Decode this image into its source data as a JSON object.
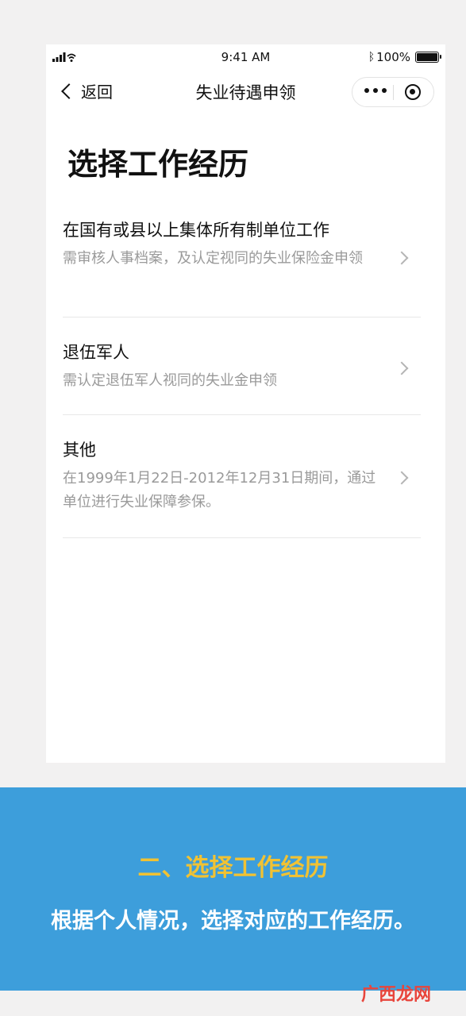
{
  "status_bar": {
    "time": "9:41 AM",
    "battery": "100%"
  },
  "navbar": {
    "back_label": "返回",
    "title": "失业待遇申领"
  },
  "page": {
    "title": "选择工作经历"
  },
  "options": [
    {
      "title": "在国有或县以上集体所有制单位工作",
      "desc": "需审核人事档案，及认定视同的失业保险金申领"
    },
    {
      "title": "退伍军人",
      "desc": "需认定退伍军人视同的失业金申领"
    },
    {
      "title": "其他",
      "desc": "在1999年1月22日-2012年12月31日期间，通过单位进行失业保障参保。"
    }
  ],
  "banner": {
    "heading": "二、选择工作经历",
    "text": "根据个人情况，选择对应的工作经历。"
  },
  "watermark": {
    "text": "广西龙网"
  },
  "colors": {
    "banner_bg": "#3d9edb",
    "banner_heading": "#f1c233",
    "watermark": "#e8453c"
  }
}
